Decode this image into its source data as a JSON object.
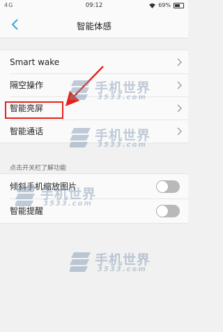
{
  "status_bar": {
    "network": "4G",
    "time": "09:12",
    "battery": "69%"
  },
  "header": {
    "title": "智能体感"
  },
  "settings": {
    "items": [
      {
        "label": "Smart wake"
      },
      {
        "label": "隔空操作"
      },
      {
        "label": "智能亮屏"
      },
      {
        "label": "智能通话"
      }
    ]
  },
  "toggles": {
    "caption": "点击开关栏了解功能",
    "items": [
      {
        "label": "倾斜手机缩放图片",
        "on": false
      },
      {
        "label": "智能提醒",
        "on": false
      }
    ]
  },
  "watermark": {
    "text": "手机世界",
    "subtext": "3533.com"
  },
  "colors": {
    "accent": "#3aa6d6",
    "highlight": "#e3231b",
    "toggle_off": "#b9b9b9"
  }
}
